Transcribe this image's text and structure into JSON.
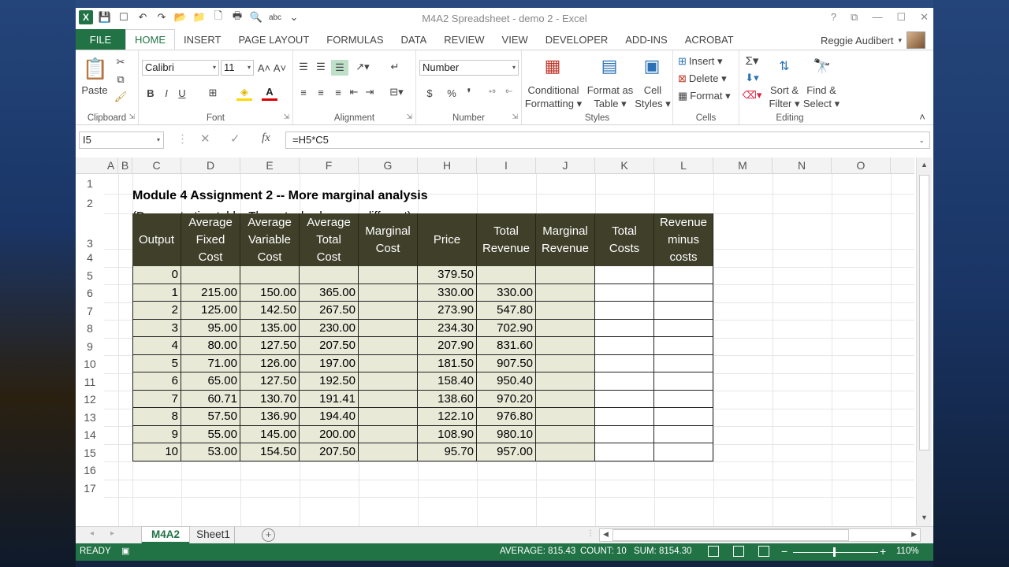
{
  "window": {
    "title": "M4A2 Spreadsheet - demo 2 - Excel",
    "help": "?",
    "restore": "⧉",
    "minimize": "—",
    "maximize": "☐",
    "close": "✕"
  },
  "qat": {
    "logo": "X",
    "save": "💾",
    "touch": "☐",
    "undo": "↶",
    "redo": "↷",
    "open": "📂",
    "folder": "📁",
    "new": "🗋",
    "print": "🖶",
    "preview": "🔍",
    "spell": "abc",
    "more": "⌄"
  },
  "tabs": {
    "file": "FILE",
    "home": "HOME",
    "insert": "INSERT",
    "page_layout": "PAGE LAYOUT",
    "formulas": "FORMULAS",
    "data": "DATA",
    "review": "REVIEW",
    "view": "VIEW",
    "developer": "DEVELOPER",
    "addins": "ADD-INS",
    "acrobat": "ACROBAT"
  },
  "user": {
    "name": "Reggie Audibert",
    "caret": "▾"
  },
  "ribbon": {
    "clipboard": {
      "label": "Clipboard",
      "paste": "Paste"
    },
    "font": {
      "label": "Font",
      "name": "Calibri",
      "size": "11",
      "grow": "A˄",
      "shrink": "A˅",
      "bold": "B",
      "italic": "I",
      "underline": "U"
    },
    "alignment": {
      "label": "Alignment"
    },
    "number": {
      "label": "Number",
      "format": "Number",
      "currency": "$",
      "percent": "%",
      "comma": "❜"
    },
    "styles": {
      "label": "Styles",
      "conditional_1": "Conditional",
      "conditional_2": "Formatting ▾",
      "table_1": "Format as",
      "table_2": "Table ▾",
      "cell_1": "Cell",
      "cell_2": "Styles ▾"
    },
    "cells": {
      "label": "Cells",
      "insert": "Insert ▾",
      "delete": "Delete ▾",
      "format": "Format ▾"
    },
    "editing": {
      "label": "Editing",
      "sort_1": "Sort &",
      "sort_2": "Filter ▾",
      "find_1": "Find &",
      "find_2": "Select ▾"
    },
    "collapse": "˄"
  },
  "formula_bar": {
    "name_box": "I5",
    "cancel": "✕",
    "enter": "✓",
    "fx": "fx",
    "formula": "=H5*C5"
  },
  "columns": [
    "A",
    "B",
    "C",
    "D",
    "E",
    "F",
    "G",
    "H",
    "I",
    "J",
    "K",
    "L",
    "M",
    "N",
    "O"
  ],
  "rows": [
    "1",
    "2",
    "3",
    "4",
    "5",
    "6",
    "7",
    "8",
    "9",
    "10",
    "11",
    "12",
    "13",
    "14",
    "15",
    "16",
    "17"
  ],
  "sheet": {
    "title": "Module 4 Assignment 2 -- More marginal analysis",
    "subtitle": "(Demonstration table. The actual values are different)"
  },
  "table": {
    "headers": [
      [
        "Output"
      ],
      [
        "Average",
        "Fixed",
        "Cost"
      ],
      [
        "Average",
        "Variable",
        "Cost"
      ],
      [
        "Average",
        "Total",
        "Cost"
      ],
      [
        "Marginal",
        "Cost"
      ],
      [
        "Price"
      ],
      [
        "Total",
        "Revenue"
      ],
      [
        "Marginal",
        "Revenue"
      ],
      [
        "Total",
        "Costs"
      ],
      [
        "Revenue",
        "minus",
        "costs"
      ]
    ],
    "rows": [
      [
        "0",
        "",
        "",
        "",
        "",
        "379.50",
        "",
        "",
        "",
        ""
      ],
      [
        "1",
        "215.00",
        "150.00",
        "365.00",
        "",
        "330.00",
        "330.00",
        "",
        "",
        ""
      ],
      [
        "2",
        "125.00",
        "142.50",
        "267.50",
        "",
        "273.90",
        "547.80",
        "",
        "",
        ""
      ],
      [
        "3",
        "95.00",
        "135.00",
        "230.00",
        "",
        "234.30",
        "702.90",
        "",
        "",
        ""
      ],
      [
        "4",
        "80.00",
        "127.50",
        "207.50",
        "",
        "207.90",
        "831.60",
        "",
        "",
        ""
      ],
      [
        "5",
        "71.00",
        "126.00",
        "197.00",
        "",
        "181.50",
        "907.50",
        "",
        "",
        ""
      ],
      [
        "6",
        "65.00",
        "127.50",
        "192.50",
        "",
        "158.40",
        "950.40",
        "",
        "",
        ""
      ],
      [
        "7",
        "60.71",
        "130.70",
        "191.41",
        "",
        "138.60",
        "970.20",
        "",
        "",
        ""
      ],
      [
        "8",
        "57.50",
        "136.90",
        "194.40",
        "",
        "122.10",
        "976.80",
        "",
        "",
        ""
      ],
      [
        "9",
        "55.00",
        "145.00",
        "200.00",
        "",
        "108.90",
        "980.10",
        "",
        "",
        ""
      ],
      [
        "10",
        "53.00",
        "154.50",
        "207.50",
        "",
        "95.70",
        "957.00",
        "",
        "",
        ""
      ]
    ]
  },
  "sheet_tabs": {
    "active": "M4A2",
    "other": "Sheet1",
    "add": "+",
    "prev": "◂",
    "next": "▸",
    "more": "⋮"
  },
  "status": {
    "ready": "READY",
    "average": "AVERAGE: 815.43",
    "count": "COUNT: 10",
    "sum": "SUM: 8154.30",
    "zoom_minus": "−",
    "zoom_plus": "+",
    "zoom": "110%"
  },
  "colors": {
    "excel_green": "#217346",
    "header_dark": "#3f3f2a",
    "cell_shaded": "#e9e9d8"
  }
}
